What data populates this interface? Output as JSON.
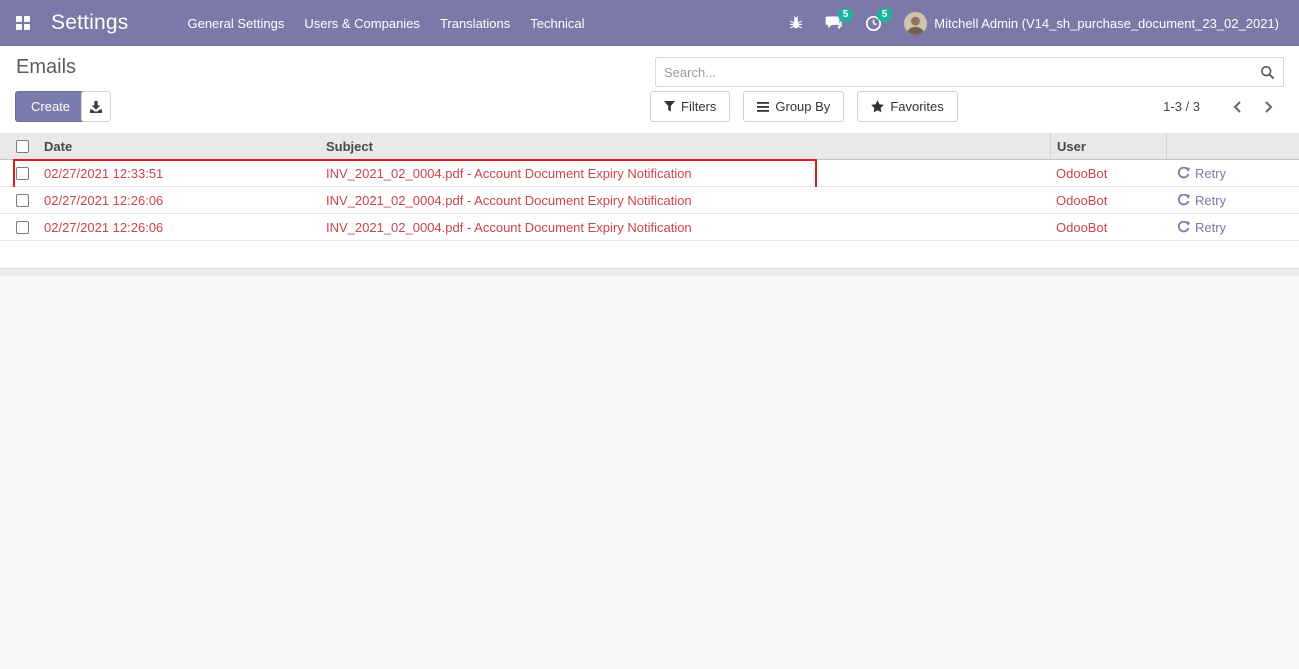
{
  "navbar": {
    "app_title": "Settings",
    "menu_items": [
      "General Settings",
      "Users & Companies",
      "Translations",
      "Technical"
    ],
    "systray": {
      "messages_badge": "5",
      "activities_badge": "5",
      "user_name": "Mitchell Admin (V14_sh_purchase_document_23_02_2021)"
    }
  },
  "control_panel": {
    "title": "Emails",
    "create_label": "Create",
    "search_placeholder": "Search...",
    "filters_label": "Filters",
    "group_by_label": "Group By",
    "favorites_label": "Favorites",
    "pager_text": "1-3 / 3"
  },
  "table": {
    "columns": {
      "date": "Date",
      "subject": "Subject",
      "user": "User"
    },
    "retry_label": "Retry",
    "rows": [
      {
        "date": "02/27/2021 12:33:51",
        "subject": "INV_2021_02_0004.pdf - Account Document Expiry Notification",
        "user": "OdooBot",
        "highlighted": true
      },
      {
        "date": "02/27/2021 12:26:06",
        "subject": "INV_2021_02_0004.pdf - Account Document Expiry Notification",
        "user": "OdooBot",
        "highlighted": false
      },
      {
        "date": "02/27/2021 12:26:06",
        "subject": "INV_2021_02_0004.pdf - Account Document Expiry Notification",
        "user": "OdooBot",
        "highlighted": false
      }
    ]
  },
  "colors": {
    "navbar_bg": "#7a79a8",
    "primary": "#7c7bad",
    "row_text_danger": "#cb444e",
    "retry_link": "#7c7bad",
    "highlight_border": "#dc1c1c",
    "badge_bg": "#1eb39c"
  }
}
